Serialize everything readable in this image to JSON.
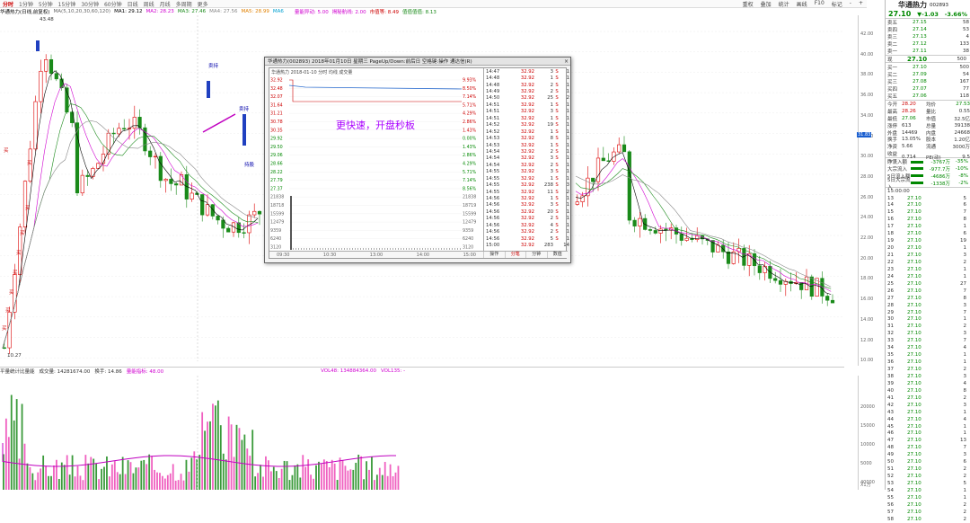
{
  "topbar": {
    "tabs": [
      "分时",
      "1分钟",
      "5分钟",
      "15分钟",
      "30分钟",
      "60分钟",
      "日线",
      "周线",
      "月线",
      "多周期",
      "更多"
    ],
    "active_tab": 0,
    "right": [
      "重权",
      "叠加",
      "统计",
      "画线",
      "F10",
      "标记",
      "-",
      "+"
    ]
  },
  "mabar": {
    "name": "华通热力(日线,前复权)",
    "ma_label": "MA(5,10,20,30,60,120)",
    "ma1": "MA1: 29.12",
    "ma2": "MA2: 28.23",
    "ma3": "MA3: 27.46",
    "ma4": "MA4: 27.56",
    "ma5": "MA5: 28.99",
    "ma6": "MA6",
    "ind1": "量能异动: 5.00",
    "ind2": "揭秘航线: 2.00",
    "ind3": "市值等: 8.49",
    "ind4": "值值值值: 8.13",
    "colors": {
      "ma1": "#000000",
      "ma2": "#d000d0",
      "ma3": "#1a8a1a",
      "ma4": "#888888",
      "ma5": "#e08000",
      "ma6": "#00a0d0"
    }
  },
  "main": {
    "high_label": "43.48",
    "low_label": "10.27",
    "buy_labels": [
      "买",
      "买",
      "买",
      "买",
      "买",
      "买",
      "买",
      "买",
      "买"
    ],
    "sell_labels": [
      "卖持",
      "卖持",
      "持股"
    ],
    "price_axis": [
      "42.00",
      "40.00",
      "38.00",
      "36.00",
      "34.00",
      "32.00",
      "30.00",
      "28.00",
      "26.00",
      "24.00",
      "22.00",
      "20.00",
      "18.00",
      "16.00",
      "14.00",
      "12.00",
      "10.00"
    ],
    "current_price_marker": "31.83"
  },
  "volume": {
    "title": "平量统计比量能",
    "vol": "成交量: 14281674.00",
    "turnover": "换手: 14.86",
    "ind": "量能指标: 48.00",
    "vol2": "VOL48: 134884364.00",
    "vol3": "VOL135: -",
    "axis": [
      "20000",
      "15000",
      "10000",
      "5000",
      "40000",
      "30000",
      "20000",
      "10000"
    ],
    "axis_unit": "X1万"
  },
  "popup": {
    "title": "华通热力(002893) 2018年01月10日 星期三 PageUp/Down:前后日 空格键:操作 通达信(R)",
    "close": "×",
    "mini_head": "华通热力    2018-01-10 分时  均线  成交量",
    "overlay_text": "更快速，开盘秒板",
    "y_left": [
      "32.92",
      "32.48",
      "32.07",
      "31.64",
      "31.21",
      "30.78",
      "30.35",
      "29.92",
      "29.50",
      "29.06",
      "28.66",
      "28.22",
      "27.79",
      "27.37",
      "21838",
      "18718",
      "15599",
      "12479",
      "9359",
      "6240",
      "3120"
    ],
    "y_right": [
      "9.93%",
      "8.50%",
      "7.14%",
      "5.71%",
      "4.29%",
      "2.86%",
      "1.43%",
      "0.00%",
      "1.43%",
      "2.86%",
      "4.29%",
      "5.71%",
      "7.14%",
      "8.56%",
      "21838",
      "18719",
      "15599",
      "12479",
      "9359",
      "6240",
      "3120"
    ],
    "x_axis": [
      "09:30",
      "10:30",
      "13:00",
      "14:00",
      "15:00"
    ],
    "buttons": [
      "操作",
      "分笔",
      "分钟",
      "数值"
    ],
    "ticks": [
      [
        "14:47",
        "32.92",
        "3",
        "S",
        "1"
      ],
      [
        "14:48",
        "32.92",
        "1",
        "S",
        "1"
      ],
      [
        "14:48",
        "32.92",
        "2",
        "S",
        "1"
      ],
      [
        "14:49",
        "32.92",
        "2",
        "S",
        "1"
      ],
      [
        "14:50",
        "32.92",
        "25",
        "S",
        "2"
      ],
      [
        "14:51",
        "32.92",
        "1",
        "S",
        "1"
      ],
      [
        "14:51",
        "32.92",
        "3",
        "S",
        "1"
      ],
      [
        "14:51",
        "32.92",
        "1",
        "S",
        "1"
      ],
      [
        "14:52",
        "32.92",
        "19",
        "S",
        "1"
      ],
      [
        "14:52",
        "32.92",
        "1",
        "S",
        "1"
      ],
      [
        "14:53",
        "32.92",
        "8",
        "S",
        "1"
      ],
      [
        "14:53",
        "32.92",
        "1",
        "S",
        "1"
      ],
      [
        "14:54",
        "32.92",
        "2",
        "S",
        "1"
      ],
      [
        "14:54",
        "32.92",
        "3",
        "S",
        "1"
      ],
      [
        "14:54",
        "32.92",
        "2",
        "S",
        "1"
      ],
      [
        "14:55",
        "32.92",
        "3",
        "S",
        "1"
      ],
      [
        "14:55",
        "32.92",
        "1",
        "S",
        "1"
      ],
      [
        "14:55",
        "32.92",
        "238",
        "S",
        "3"
      ],
      [
        "14:55",
        "32.92",
        "11",
        "S",
        "2"
      ],
      [
        "14:56",
        "32.92",
        "1",
        "S",
        "1"
      ],
      [
        "14:56",
        "32.92",
        "3",
        "S",
        "1"
      ],
      [
        "14:56",
        "32.92",
        "20",
        "S",
        "1"
      ],
      [
        "14:56",
        "32.92",
        "2",
        "S",
        "1"
      ],
      [
        "14:56",
        "32.92",
        "4",
        "S",
        "1"
      ],
      [
        "14:56",
        "32.92",
        "2",
        "S",
        "1"
      ],
      [
        "14:56",
        "32.92",
        "5",
        "S",
        "1"
      ],
      [
        "15:00",
        "32.92",
        "283",
        "",
        "14"
      ]
    ]
  },
  "panel": {
    "name": "华通热力",
    "code": "002893",
    "price": "27.10",
    "change": "▼-1.03",
    "pct": "-3.66%",
    "asks": [
      [
        "卖五",
        "27.15",
        "58"
      ],
      [
        "卖四",
        "27.14",
        "53"
      ],
      [
        "卖三",
        "27.13",
        "4"
      ],
      [
        "卖二",
        "27.12",
        "133"
      ],
      [
        "卖一",
        "27.11",
        "38"
      ]
    ],
    "now_label": "现",
    "now_price": "27.10",
    "now_vol": "500",
    "bids": [
      [
        "买一",
        "27.10",
        "500"
      ],
      [
        "买二",
        "27.09",
        "54"
      ],
      [
        "买三",
        "27.08",
        "167"
      ],
      [
        "买四",
        "27.07",
        "77"
      ],
      [
        "买五",
        "27.06",
        "118"
      ]
    ],
    "stats": [
      [
        "今开",
        "28.20",
        "均价",
        "27.53"
      ],
      [
        "最高",
        "28.26",
        "量比",
        "0.55"
      ],
      [
        "最低",
        "27.06",
        "市值",
        "32.5亿"
      ],
      [
        "涨停",
        "613",
        "总量",
        "39138"
      ],
      [
        "外盘",
        "14469",
        "内盘",
        "24668"
      ],
      [
        "换手",
        "13.05%",
        "股本",
        "1.20亿"
      ],
      [
        "净资",
        "5.66",
        "流通",
        "3000万"
      ],
      [
        "收益(一)",
        "0.714",
        "PE(动)",
        "9.5"
      ]
    ],
    "flows": [
      [
        "净流入额",
        "-3767万",
        "-35%"
      ],
      [
        "大宗流入",
        "-977.7万",
        "-10%"
      ],
      [
        "5日流入额",
        "-4686万",
        "-8%"
      ],
      [
        "5日大宗流入",
        "-1338万",
        "-2%"
      ]
    ],
    "ticks_head": "15:00:00",
    "ticks": [
      [
        "13",
        "27.10",
        "5"
      ],
      [
        "14",
        "27.10",
        "6"
      ],
      [
        "15",
        "27.10",
        "7"
      ],
      [
        "16",
        "27.10",
        "8"
      ],
      [
        "17",
        "27.10",
        "1"
      ],
      [
        "18",
        "27.10",
        "6"
      ],
      [
        "19",
        "27.10",
        "19"
      ],
      [
        "20",
        "27.10",
        "1"
      ],
      [
        "21",
        "27.10",
        "3"
      ],
      [
        "22",
        "27.10",
        "2"
      ],
      [
        "23",
        "27.10",
        "1"
      ],
      [
        "24",
        "27.10",
        "1"
      ],
      [
        "25",
        "27.10",
        "27"
      ],
      [
        "26",
        "27.10",
        "7"
      ],
      [
        "27",
        "27.10",
        "8"
      ],
      [
        "28",
        "27.10",
        "3"
      ],
      [
        "29",
        "27.10",
        "7"
      ],
      [
        "30",
        "27.10",
        "1"
      ],
      [
        "31",
        "27.10",
        "2"
      ],
      [
        "32",
        "27.10",
        "3"
      ],
      [
        "33",
        "27.10",
        "7"
      ],
      [
        "34",
        "27.10",
        "4"
      ],
      [
        "35",
        "27.10",
        "1"
      ],
      [
        "36",
        "27.10",
        "1"
      ],
      [
        "37",
        "27.10",
        "2"
      ],
      [
        "38",
        "27.10",
        "3"
      ],
      [
        "39",
        "27.10",
        "4"
      ],
      [
        "40",
        "27.10",
        "8"
      ],
      [
        "41",
        "27.10",
        "2"
      ],
      [
        "42",
        "27.10",
        "3"
      ],
      [
        "43",
        "27.10",
        "1"
      ],
      [
        "44",
        "27.10",
        "4"
      ],
      [
        "45",
        "27.10",
        "1"
      ],
      [
        "46",
        "27.10",
        "1"
      ],
      [
        "47",
        "27.10",
        "13"
      ],
      [
        "48",
        "27.10",
        "7"
      ],
      [
        "49",
        "27.10",
        "3"
      ],
      [
        "50",
        "27.10",
        "6"
      ],
      [
        "51",
        "27.10",
        "2"
      ],
      [
        "52",
        "27.10",
        "2"
      ],
      [
        "53",
        "27.10",
        "5"
      ],
      [
        "54",
        "27.10",
        "1"
      ],
      [
        "55",
        "27.10",
        "1"
      ],
      [
        "56",
        "27.10",
        "2"
      ],
      [
        "57",
        "27.10",
        "2"
      ],
      [
        "58",
        "27.10",
        "2"
      ]
    ]
  }
}
